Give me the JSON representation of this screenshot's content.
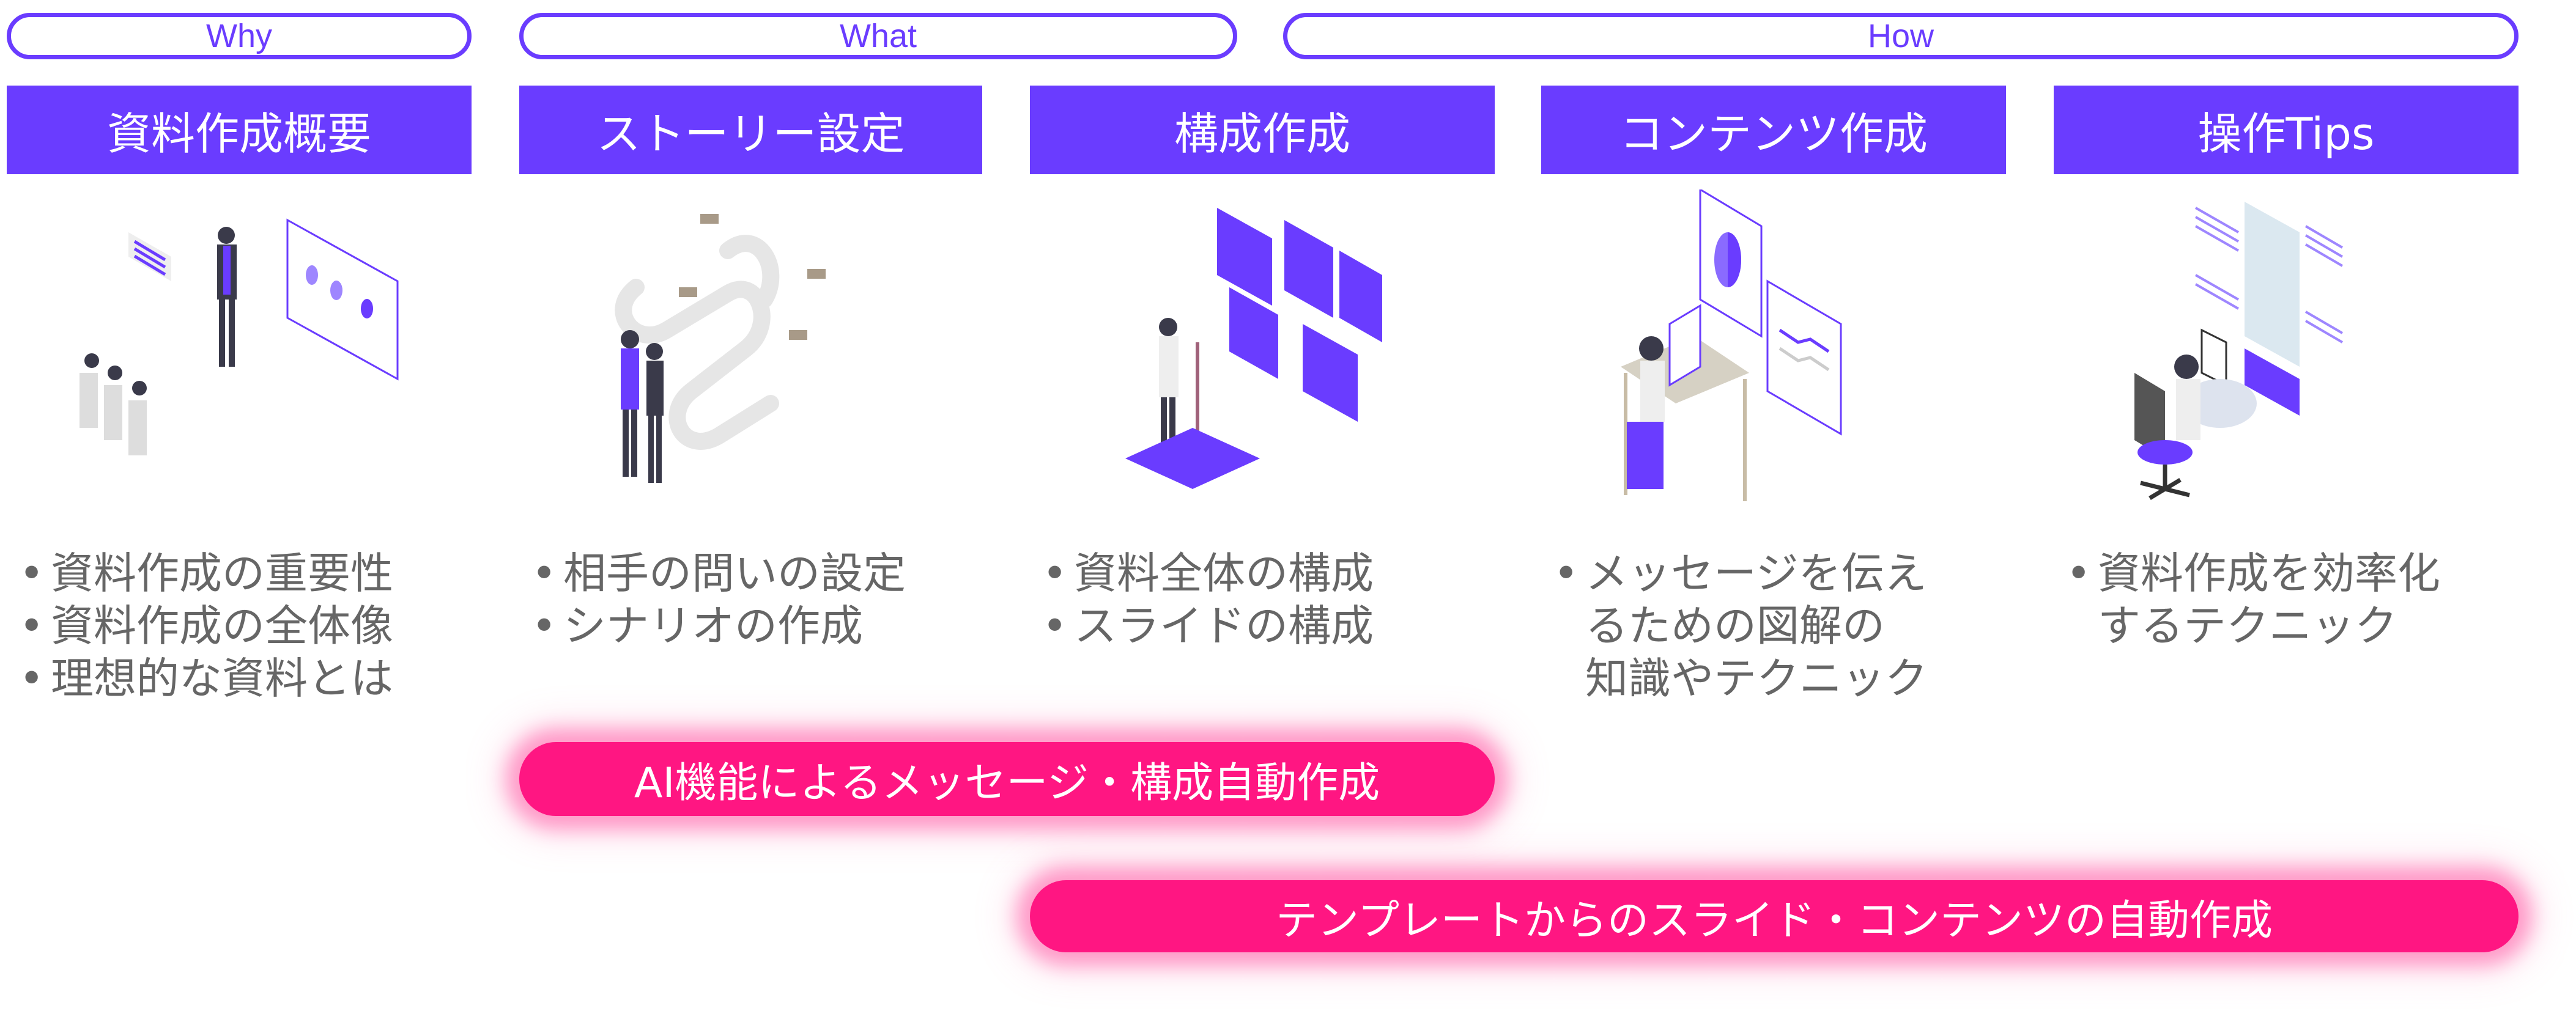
{
  "phases": [
    {
      "label": "Why"
    },
    {
      "label": "What"
    },
    {
      "label": "How"
    }
  ],
  "columns": [
    {
      "title": "資料作成概要",
      "illustration": "presentation-audience-icon",
      "bullets": [
        "資料作成の重要性",
        "資料作成の全体像",
        "理想的な資料とは"
      ]
    },
    {
      "title": "ストーリー設定",
      "illustration": "winding-road-signpost-icon",
      "bullets": [
        "相手の問いの設定",
        "シナリオの作成"
      ]
    },
    {
      "title": "構成作成",
      "illustration": "slide-boards-planning-icon",
      "bullets": [
        "資料全体の構成",
        "スライドの構成"
      ]
    },
    {
      "title": "コンテンツ作成",
      "illustration": "desk-charts-analysis-icon",
      "bullets": [
        "メッセージを伝え",
        "るための図解の",
        "知識やテクニック"
      ]
    },
    {
      "title": "操作Tips",
      "illustration": "office-chair-workstation-icon",
      "bullets": [
        "資料作成を効率化",
        "するテクニック"
      ]
    }
  ],
  "features": [
    {
      "label": "AI機能によるメッセージ・構成自動作成"
    },
    {
      "label": "テンプレートからのスライド・コンテンツの自動作成"
    }
  ],
  "colors": {
    "accent": "#6A3CFF",
    "highlight": "#FF1682",
    "body_text": "#666666"
  }
}
